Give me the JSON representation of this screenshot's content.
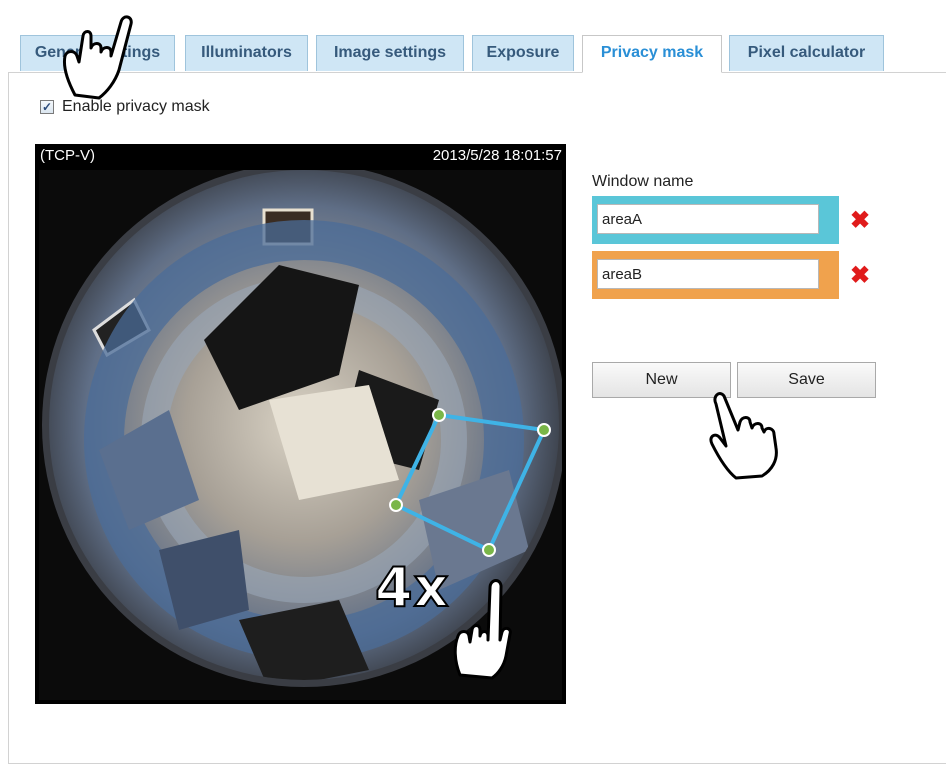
{
  "tabs": [
    {
      "label": "General settings",
      "active": false
    },
    {
      "label": "Illuminators",
      "active": false
    },
    {
      "label": "Image settings",
      "active": false
    },
    {
      "label": "Exposure",
      "active": false
    },
    {
      "label": "Privacy mask",
      "active": true
    },
    {
      "label": "Pixel calculator",
      "active": false
    }
  ],
  "enable": {
    "label": "Enable privacy mask",
    "checked": true,
    "check_glyph": "✓"
  },
  "video": {
    "source": "(TCP-V)",
    "timestamp": "2013/5/28 18:01:57"
  },
  "window_name": {
    "label": "Window name",
    "areas": [
      {
        "value": "areaA",
        "color": "#5ac6d8"
      },
      {
        "value": "areaB",
        "color": "#f0a24d"
      }
    ],
    "delete_glyph": "✖"
  },
  "buttons": {
    "new_label": "New",
    "save_label": "Save"
  },
  "overlay": {
    "zoom_label": "4x",
    "mask_color": "#3fb3e6",
    "handle_color": "#7ab648"
  }
}
